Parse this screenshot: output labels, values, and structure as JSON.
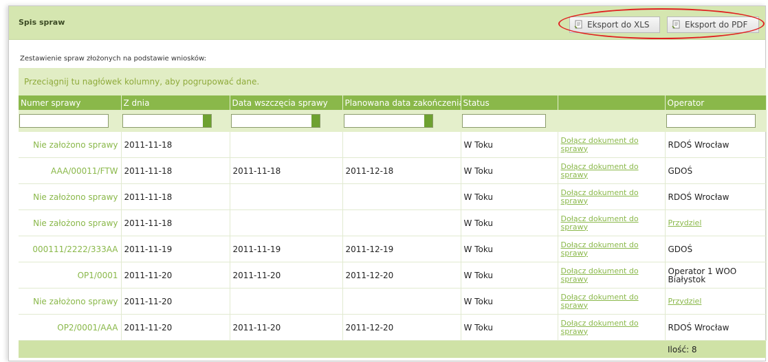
{
  "panel": {
    "title": "Spis spraw",
    "export_xls": "Eksport do XLS",
    "export_pdf": "Eksport do PDF",
    "accent": "#8ab84a",
    "header_bg": "#d5e6b0",
    "annotation_color": "#e02020"
  },
  "description": "Zestawienie spraw złożonych na podstawie wniosków:",
  "grid": {
    "group_hint": "Przeciągnij tu nagłówek kolumny, aby pogrupować dane.",
    "columns": [
      "Numer sprawy",
      "Z dnia",
      "Data wszczęcia sprawy",
      "Planowana data zakończenia",
      "Status",
      "",
      "Operator"
    ],
    "rows": [
      {
        "numer": "Nie założono sprawy",
        "z_dnia": "2011-11-18",
        "wszczecie": "",
        "planowana": "",
        "status": "W Toku",
        "akcja": "Dołącz dokument do sprawy",
        "operator": "RDOŚ Wrocław",
        "operator_link": false
      },
      {
        "numer": "AAA/00011/FTW",
        "z_dnia": "2011-11-18",
        "wszczecie": "2011-11-18",
        "planowana": "2011-12-18",
        "status": "W Toku",
        "akcja": "Dołącz dokument do sprawy",
        "operator": "GDOŚ",
        "operator_link": false
      },
      {
        "numer": "Nie założono sprawy",
        "z_dnia": "2011-11-18",
        "wszczecie": "",
        "planowana": "",
        "status": "W Toku",
        "akcja": "Dołącz dokument do sprawy",
        "operator": "RDOŚ Wrocław",
        "operator_link": false
      },
      {
        "numer": "Nie założono sprawy",
        "z_dnia": "2011-11-18",
        "wszczecie": "",
        "planowana": "",
        "status": "W Toku",
        "akcja": "Dołącz dokument do sprawy",
        "operator": "Przydziel",
        "operator_link": true
      },
      {
        "numer": "000111/2222/333AA",
        "z_dnia": "2011-11-19",
        "wszczecie": "2011-11-19",
        "planowana": "2011-12-19",
        "status": "W Toku",
        "akcja": "Dołącz dokument do sprawy",
        "operator": "GDOŚ",
        "operator_link": false
      },
      {
        "numer": "OP1/0001",
        "z_dnia": "2011-11-20",
        "wszczecie": "2011-11-20",
        "planowana": "2011-12-20",
        "status": "W Toku",
        "akcja": "Dołącz dokument do sprawy",
        "operator": "Operator 1 WOO Białystok",
        "operator_link": false
      },
      {
        "numer": "Nie założono sprawy",
        "z_dnia": "2011-11-20",
        "wszczecie": "",
        "planowana": "",
        "status": "W Toku",
        "akcja": "Dołącz dokument do sprawy",
        "operator": "Przydziel",
        "operator_link": true
      },
      {
        "numer": "OP2/0001/AAA",
        "z_dnia": "2011-11-20",
        "wszczecie": "2011-11-20",
        "planowana": "2011-12-20",
        "status": "W Toku",
        "akcja": "Dołącz dokument do sprawy",
        "operator": "RDOŚ Wrocław",
        "operator_link": false
      }
    ],
    "footer_count": "Ilość: 8"
  }
}
